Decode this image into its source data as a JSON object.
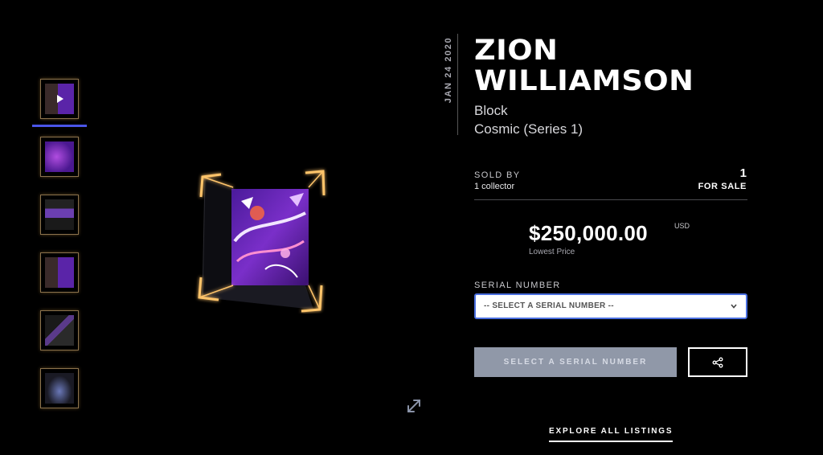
{
  "moment": {
    "date": "JAN 24 2020",
    "player_line1": "ZION",
    "player_line2": "WILLIAMSON",
    "play_type": "Block",
    "set": "Cosmic (Series 1)"
  },
  "listing": {
    "sold_by_label": "SOLD BY",
    "sold_by_value": "1 collector",
    "for_sale_count": "1",
    "for_sale_label": "FOR SALE",
    "price": "$250,000.00",
    "currency": "USD",
    "price_caption": "Lowest Price"
  },
  "serial": {
    "label": "SERIAL NUMBER",
    "selected": "-- SELECT A SERIAL NUMBER --"
  },
  "actions": {
    "select_button": "SELECT A SERIAL NUMBER",
    "explore_link": "EXPLORE ALL LISTINGS"
  },
  "thumbnails": {
    "count": 6,
    "active_index": 0,
    "active_color": "#4a55e8"
  },
  "colors": {
    "accent": "#4a6fe0",
    "frame_glow": "#ffc46a",
    "artwork_purple": "#7a2fc9"
  },
  "icons": [
    "chevron-down-icon",
    "share-icon",
    "expand-icon",
    "play-icon"
  ]
}
